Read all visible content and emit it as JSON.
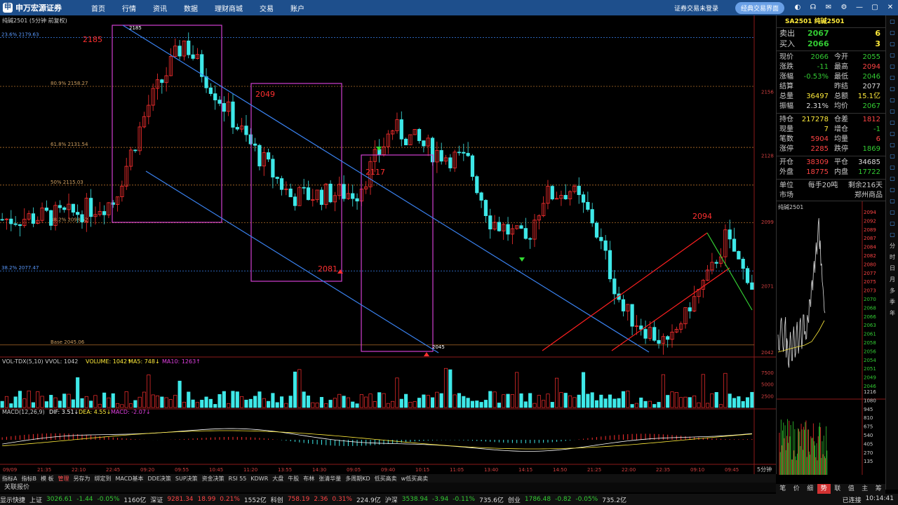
{
  "app": {
    "logo_text": "申万宏源证券",
    "nav": [
      "首页",
      "行情",
      "资讯",
      "数据",
      "理财商城",
      "交易",
      "账户"
    ],
    "login_status": "证券交易未登录",
    "classic_button": "经典交易界面",
    "clock": "10:14:41"
  },
  "colors": {
    "up": "#ff4444",
    "down": "#33cc33",
    "accent": "#1e4f8c",
    "box": "#d040d0",
    "trendline": "#3a82f0"
  },
  "chart": {
    "title": "纯碱2501 (5分钟 前复权)",
    "fib_labels": [
      {
        "text": "23.6% 2179.63",
        "price": 2179.63
      },
      {
        "text": "80.9% 2158.27",
        "price": 2158.27
      },
      {
        "text": "61.8% 2131.54",
        "price": 2131.54
      },
      {
        "text": "50% 2115.03",
        "price": 2115.03
      },
      {
        "text": "38.2% 2098.52",
        "price": 2098.52
      },
      {
        "text": "38.2% 2077.47",
        "price": 2077.47
      },
      {
        "text": "Base 2045.06",
        "price": 2045.06
      }
    ],
    "annotations": [
      {
        "text": "2185",
        "color": "#ff3030"
      },
      {
        "text": "2049",
        "color": "#ff3030"
      },
      {
        "text": "2117",
        "color": "#ff3030"
      },
      {
        "text": "2081",
        "color": "#ff3030"
      },
      {
        "text": "2094",
        "color": "#ff3030"
      }
    ],
    "point_labels": [
      "2185",
      "2045"
    ],
    "price_axis": [
      "2156",
      "2128",
      "2099",
      "2071",
      "2042"
    ],
    "time_axis": [
      "09/09",
      "21:35",
      "22:10",
      "22:45",
      "09:20",
      "09:55",
      "10:45",
      "11:20",
      "13:55",
      "14:30",
      "09:05",
      "09:40",
      "10:15",
      "11:05",
      "13:40",
      "14:15",
      "14:50",
      "21:25",
      "22:00",
      "22:35",
      "09:10",
      "09:45"
    ],
    "period_label": "5分钟"
  },
  "volume": {
    "label": "VOL-TDX(5,10)",
    "vvol": "VVOL: 1042",
    "volume": "VOLUME: 1042↑",
    "ma5": "MA5: 748↓",
    "ma10": "MA10: 1263↑",
    "axis": [
      "7500",
      "5000",
      "2500"
    ]
  },
  "macd": {
    "label": "MACD(12,26,9)",
    "dif": "DIF: 3.51↓",
    "dea": "DEA: 4.55↓",
    "macd": "MACD: -2.07↓"
  },
  "quote": {
    "header": "SA2501  纯碱2501",
    "sell": {
      "label": "卖出",
      "price": "2067",
      "vol": "6"
    },
    "buy": {
      "label": "买入",
      "price": "2066",
      "vol": "3"
    },
    "rows": [
      {
        "l1": "现价",
        "v1": "2066",
        "c1": "dn",
        "l2": "今开",
        "v2": "2055",
        "c2": "dn"
      },
      {
        "l1": "涨跌",
        "v1": "-11",
        "c1": "dn",
        "l2": "最高",
        "v2": "2094",
        "c2": "up"
      },
      {
        "l1": "涨幅",
        "v1": "-0.53%",
        "c1": "dn",
        "l2": "最低",
        "v2": "2046",
        "c2": "dn"
      },
      {
        "l1": "结算",
        "v1": "",
        "c1": "wh",
        "l2": "昨结",
        "v2": "2077",
        "c2": "wh"
      },
      {
        "l1": "总量",
        "v1": "36497",
        "c1": "yl",
        "l2": "总额",
        "v2": "15.1亿",
        "c2": "yl"
      },
      {
        "l1": "振幅",
        "v1": "2.31%",
        "c1": "wh",
        "l2": "均价",
        "v2": "2067",
        "c2": "dn"
      }
    ],
    "rows2": [
      {
        "l1": "持仓",
        "v1": "217278",
        "c1": "yl",
        "l2": "仓差",
        "v2": "1812",
        "c2": "up"
      },
      {
        "l1": "现量",
        "v1": "7",
        "c1": "yl",
        "l2": "增仓",
        "v2": "-1",
        "c2": "dn"
      },
      {
        "l1": "笔数",
        "v1": "5904",
        "c1": "up",
        "l2": "均量",
        "v2": "6",
        "c2": "up"
      },
      {
        "l1": "涨停",
        "v1": "2285",
        "c1": "up",
        "l2": "跌停",
        "v2": "1869",
        "c2": "dn"
      }
    ],
    "rows3": [
      {
        "l1": "开仓",
        "v1": "38309",
        "c1": "up",
        "l2": "平仓",
        "v2": "34685",
        "c2": "wh"
      },
      {
        "l1": "外盘",
        "v1": "18775",
        "c1": "up",
        "l2": "内盘",
        "v2": "17722",
        "c2": "dn"
      }
    ],
    "unit_label": "单位",
    "unit_value": "每手20吨",
    "remain": "剩余216天",
    "market_label": "市场",
    "market_value": "郑州商品"
  },
  "mini": {
    "title": "纯碱2501",
    "price_axis": [
      "2094",
      "2092",
      "2089",
      "2087",
      "2084",
      "2082",
      "2080",
      "2077",
      "2075",
      "2073",
      "2070",
      "2068",
      "2066",
      "2063",
      "2061",
      "2058",
      "2056",
      "2054",
      "2051",
      "2049",
      "2046"
    ],
    "vol_axis": [
      "1216",
      "1080",
      "945",
      "810",
      "675",
      "540",
      "405",
      "270",
      "135"
    ]
  },
  "right_tools": [
    "▢",
    "▢",
    "▢",
    "▢",
    "▢",
    "▢",
    "▢",
    "▢",
    "▢",
    "▢",
    "▢",
    "▢",
    "▢",
    "▢",
    "▢",
    "▢",
    "▢",
    "▢",
    "▢",
    "▢",
    "分",
    "时",
    "日",
    "月",
    "多",
    "季",
    "年"
  ],
  "indicator_tabs": [
    "指标A",
    "指标B",
    "模 板",
    "管理",
    "另存为",
    "绑定到",
    "MACD基本",
    "DDE决策",
    "SUP决策",
    "资金决策",
    "RSI 55",
    "KDWR",
    "大盘",
    "牛股",
    "布林",
    "张清华量",
    "多周期KD",
    "低买高卖",
    "w低买高卖"
  ],
  "active_indicator": "管理",
  "row2_label": "关联报价",
  "detail_tabs": [
    "笔",
    "价",
    "细",
    "势",
    "联",
    "值",
    "主",
    "筹"
  ],
  "active_detail": "势",
  "status": [
    {
      "t": "显示快捷",
      "c": "wh"
    },
    {
      "t": "上证",
      "c": "wh"
    },
    {
      "t": "3026.61",
      "c": "dn"
    },
    {
      "t": "-1.44",
      "c": "dn"
    },
    {
      "t": "-0.05%",
      "c": "dn"
    },
    {
      "t": "1160亿",
      "c": "wh"
    },
    {
      "t": "深证",
      "c": "wh"
    },
    {
      "t": "9281.34",
      "c": "up"
    },
    {
      "t": "18.99",
      "c": "up"
    },
    {
      "t": "0.21%",
      "c": "up"
    },
    {
      "t": "1552亿",
      "c": "wh"
    },
    {
      "t": "科创",
      "c": "wh"
    },
    {
      "t": "758.19",
      "c": "up"
    },
    {
      "t": "2.36",
      "c": "up"
    },
    {
      "t": "0.31%",
      "c": "up"
    },
    {
      "t": "224.9亿",
      "c": "wh"
    },
    {
      "t": "沪深",
      "c": "wh"
    },
    {
      "t": "3538.94",
      "c": "dn"
    },
    {
      "t": "-3.94",
      "c": "dn"
    },
    {
      "t": "-0.11%",
      "c": "dn"
    },
    {
      "t": "735.6亿",
      "c": "wh"
    },
    {
      "t": "创业",
      "c": "wh"
    },
    {
      "t": "1786.48",
      "c": "dn"
    },
    {
      "t": "-0.82",
      "c": "dn"
    },
    {
      "t": "-0.05%",
      "c": "dn"
    },
    {
      "t": "735.2亿",
      "c": "wh"
    }
  ],
  "connection": "已连接"
}
